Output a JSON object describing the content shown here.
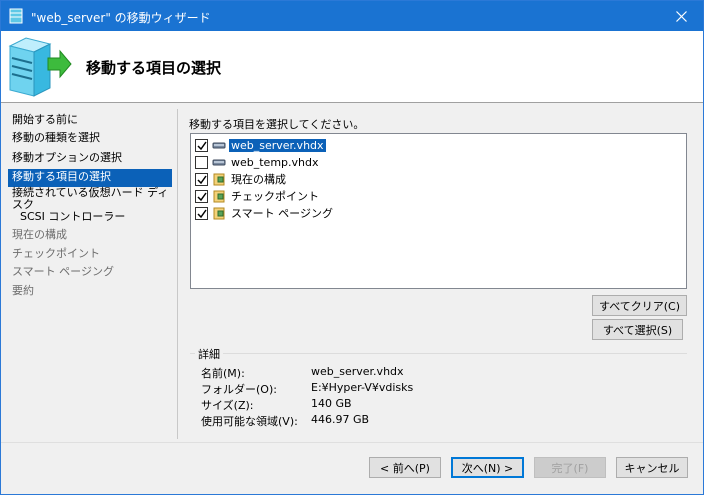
{
  "window": {
    "title": "\"web_server\" の移動ウィザード",
    "accent": "#1a73d2"
  },
  "header": {
    "title": "移動する項目の選択",
    "icon": "server-move-icon"
  },
  "nav": {
    "items": [
      {
        "label": "開始する前に",
        "state": "normal"
      },
      {
        "label": "移動の種類を選択",
        "state": "normal"
      },
      {
        "label": "移動オプションの選択",
        "state": "normal"
      },
      {
        "label": "移動する項目の選択",
        "state": "active"
      },
      {
        "label": "接続されている仮想ハード ディスク",
        "state": "normal"
      },
      {
        "label": "SCSI コントローラー",
        "state": "normal"
      },
      {
        "label": "現在の構成",
        "state": "disabled"
      },
      {
        "label": "チェックポイント",
        "state": "disabled"
      },
      {
        "label": "スマート ページング",
        "state": "disabled"
      },
      {
        "label": "要約",
        "state": "disabled"
      }
    ]
  },
  "main": {
    "instruction": "移動する項目を選択してください。",
    "items": [
      {
        "label": "web_server.vhdx",
        "checked": true,
        "icon": "disk-icon",
        "selected": true
      },
      {
        "label": "web_temp.vhdx",
        "checked": false,
        "icon": "disk-icon",
        "selected": false
      },
      {
        "label": "現在の構成",
        "checked": true,
        "icon": "config-folder-icon",
        "selected": false
      },
      {
        "label": "チェックポイント",
        "checked": true,
        "icon": "config-folder-icon",
        "selected": false
      },
      {
        "label": "スマート ページング",
        "checked": true,
        "icon": "config-folder-icon",
        "selected": false
      }
    ],
    "clear_all": "すべてクリア(C)",
    "select_all": "すべて選択(S)"
  },
  "details": {
    "title": "詳細",
    "rows": [
      {
        "label": "名前(M):",
        "value": "web_server.vhdx"
      },
      {
        "label": "フォルダー(O):",
        "value": "E:¥Hyper-V¥vdisks"
      },
      {
        "label": "サイズ(Z):",
        "value": "140 GB"
      },
      {
        "label": "使用可能な領域(V):",
        "value": "446.97 GB"
      }
    ]
  },
  "footer": {
    "back": "< 前へ(P)",
    "next": "次へ(N) >",
    "finish": "完了(F)",
    "cancel": "キャンセル"
  }
}
